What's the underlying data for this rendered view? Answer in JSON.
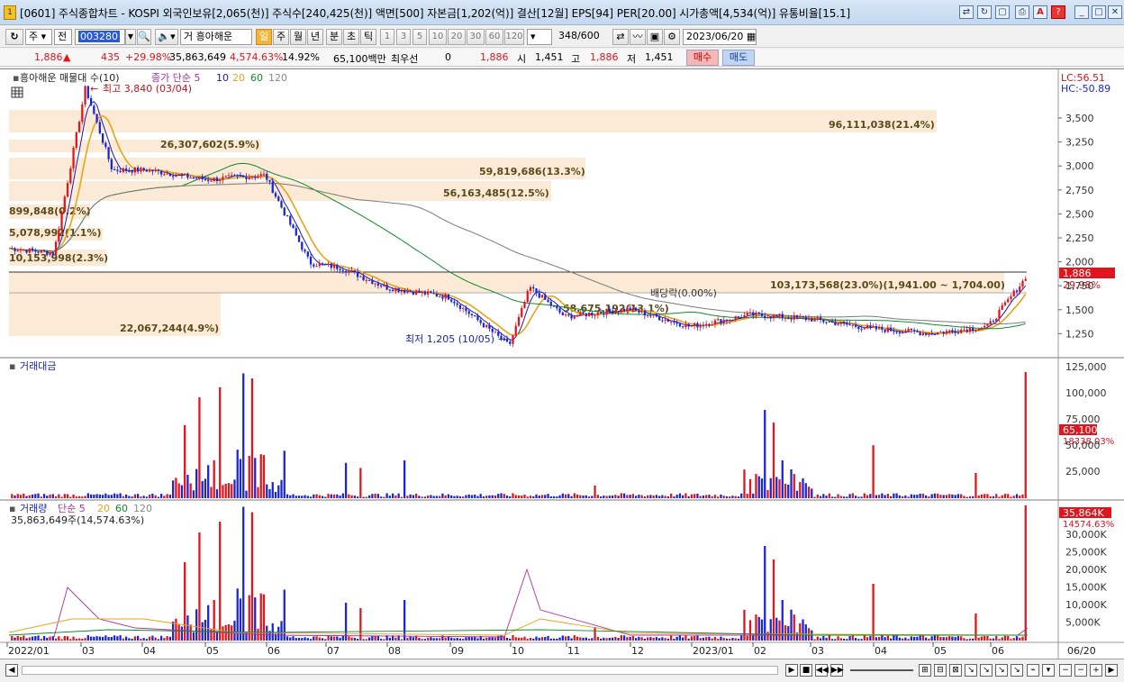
{
  "window": {
    "title": "[0601] 주식종합차트 - KOSPI 외국인보유[2,065(천)] 주식수[240,425(천)] 액면[500] 자본금[1,202(억)] 결산[12월] EPS[94] PER[20.00] 시가총액[4,534(억)] 유통비율[15.1]",
    "icon_label": "1"
  },
  "toolbar": {
    "market_type": "주",
    "scope": "전",
    "code": "003280",
    "stock_name": "흥아해운",
    "periods": [
      "일",
      "주",
      "월",
      "년",
      "분",
      "초",
      "틱"
    ],
    "active_period": "일",
    "intervals": [
      "1",
      "3",
      "5",
      "10",
      "20",
      "30",
      "60",
      "120"
    ],
    "count": "348",
    "count_max": "/600",
    "date": "2023/06/20",
    "name_prefix": "거"
  },
  "quote": {
    "price": "1,886",
    "change": "435",
    "change_rate": "+29.98%",
    "volume": "35,863,649",
    "volume_rate": "4,574.63%",
    "turnover": "14.92%",
    "amount": "65,100백만",
    "best_bid_label": "최우선",
    "best_bid": "0",
    "best_ask": "1,886",
    "open_label": "시",
    "open": "1,451",
    "high_label": "고",
    "high": "1,886",
    "low_label": "저",
    "low": "1,451",
    "buy_label": "매수",
    "sell_label": "매도"
  },
  "price_panel": {
    "legend_name": "흥아해운 매물대 수(10)",
    "legend_ma": "종가 단순 5",
    "legend_ma_periods": [
      "10",
      "20",
      "60",
      "120"
    ],
    "high_note": "최고 3,840 (03/04)",
    "low_note": "최저 1,205 (10/05)",
    "dividend_note": "배당락(0.00%)",
    "lc": "LC:56.51",
    "hc": "HC:-50.89",
    "current_price": "1,886",
    "current_rate": "29.98%",
    "y_ticks": [
      "3,500",
      "3,250",
      "3,000",
      "2,750",
      "2,500",
      "2,250",
      "2,000",
      "1,750",
      "1,500",
      "1,250"
    ],
    "volume_profile": [
      {
        "label": "96,111,038(21.4%)"
      },
      {
        "label": "26,307,602(5.9%)"
      },
      {
        "label": "59,819,686(13.3%)"
      },
      {
        "label": "56,163,485(12.5%)"
      },
      {
        "label": "899,848(0.2%)"
      },
      {
        "label": "5,078,992(1.1%)"
      },
      {
        "label": "10,153,998(2.3%)"
      },
      {
        "label": "103,173,568(23.0%)(1,941.00 ~ 1,704.00)"
      },
      {
        "label": "22,067,244(4.9%)"
      },
      {
        "label": "58,675,192(13.1%)"
      }
    ]
  },
  "amount_panel": {
    "title": "거래대금",
    "y_ticks": [
      "125,000",
      "100,000",
      "75,000",
      "50,000",
      "25,000"
    ],
    "current_value": "65,100",
    "current_sub": "18338.03%"
  },
  "volume_panel": {
    "title": "거래량",
    "legend_ma": "단순 5",
    "legend_ma_periods": [
      "20",
      "60",
      "120"
    ],
    "note": "35,863,649주(14,574.63%)",
    "y_ticks": [
      "30,000K",
      "25,000K",
      "20,000K",
      "15,000K",
      "10,000K",
      "5,000K"
    ],
    "current_value": "35,864K",
    "current_sub": "14574.63%"
  },
  "x_axis": {
    "labels": [
      "2022/01",
      "03",
      "04",
      "05",
      "06",
      "07",
      "08",
      "09",
      "10",
      "11",
      "12",
      "2023/01",
      "02",
      "03",
      "04",
      "05",
      "06"
    ],
    "end_label": "06/20"
  },
  "colors": {
    "up": "#e0161e",
    "down": "#1a25d6",
    "ma5": "#1a1ab0",
    "ma10": "#e8a417",
    "ma20": "#0f8a2f",
    "ma60": "#7a7a7a",
    "profile": "#fbead6"
  },
  "chart_data": {
    "type": "candlestick",
    "x_range": [
      "2022/01",
      "2023/06/20"
    ],
    "price_ylim": [
      1100,
      3900
    ],
    "high": {
      "value": 3840,
      "date": "03/04"
    },
    "low": {
      "value": 1205,
      "date": "10/05"
    },
    "close_last": 1886,
    "close_path": [
      [
        "2022/01",
        2200
      ],
      [
        "2022/02 mid",
        2150
      ],
      [
        "2022/03/04",
        3840
      ],
      [
        "2022/03",
        3000
      ],
      [
        "2022/04",
        3000
      ],
      [
        "2022/05",
        2900
      ],
      [
        "2022/06",
        2950
      ],
      [
        "2022/06 end",
        2050
      ],
      [
        "2022/07",
        2000
      ],
      [
        "2022/08",
        1800
      ],
      [
        "2022/09",
        1700
      ],
      [
        "2022/10/05",
        1205
      ],
      [
        "2022/10 mid",
        1800
      ],
      [
        "2022/11",
        1500
      ],
      [
        "2022/12",
        1580
      ],
      [
        "2023/01",
        1400
      ],
      [
        "2023/02",
        1520
      ],
      [
        "2023/03",
        1480
      ],
      [
        "2023/04",
        1380
      ],
      [
        "2023/05",
        1330
      ],
      [
        "2023/06",
        1400
      ],
      [
        "2023/06/20",
        1886
      ]
    ],
    "volume_spikes_k": [
      [
        "2022/02 end",
        20000
      ],
      [
        "2022/03",
        31000
      ],
      [
        "2022/10",
        23000
      ],
      [
        "2022/10 mid",
        13000
      ],
      [
        "2022/11",
        9000
      ],
      [
        "2023/06/20",
        35864
      ]
    ]
  }
}
